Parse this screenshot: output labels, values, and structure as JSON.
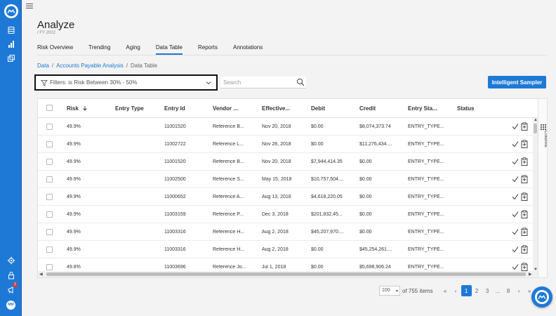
{
  "app": {
    "title": "Analyze",
    "subtitle": "/ FY 2022",
    "accent": "#1e79d6",
    "notification_count": "1",
    "avatar_initials": "MM"
  },
  "tabs": [
    {
      "label": "Risk Overview"
    },
    {
      "label": "Trending"
    },
    {
      "label": "Aging"
    },
    {
      "label": "Data Table",
      "active": true
    },
    {
      "label": "Reports"
    },
    {
      "label": "Annotations"
    }
  ],
  "breadcrumb": {
    "items": [
      "Data",
      "Accounts Payable Analysis",
      "Data Table"
    ],
    "separator": "/"
  },
  "filter": {
    "label": "Filters: is Risk Between 30% - 50%"
  },
  "search": {
    "placeholder": "Search"
  },
  "toolbar": {
    "sampler_label": "Intelligent Sampler",
    "columns_label": "Columns"
  },
  "table": {
    "columns": [
      "Risk",
      "Entry Type",
      "Entry Id",
      "Vendor ...",
      "Effective...",
      "Debit",
      "Credit",
      "Entry Sta...",
      "Status"
    ],
    "rows": [
      {
        "risk": "49.9%",
        "entry_type": "",
        "entry_id": "11001520",
        "vendor": "Reference B...",
        "effective": "Nov 20, 2018",
        "debit": "$0.00",
        "credit": "$8,074,373.74",
        "entry_status": "ENTRY_TYPE...",
        "status": ""
      },
      {
        "risk": "49.9%",
        "entry_type": "",
        "entry_id": "11002722",
        "vendor": "Reference L...",
        "effective": "Nov 28, 2018",
        "debit": "$0.00",
        "credit": "$11,276,434....",
        "entry_status": "ENTRY_TYPE...",
        "status": ""
      },
      {
        "risk": "49.9%",
        "entry_type": "",
        "entry_id": "11001520",
        "vendor": "Reference B...",
        "effective": "Nov 20, 2018",
        "debit": "$7,944,414.35",
        "credit": "$0.00",
        "entry_status": "ENTRY_TYPE...",
        "status": ""
      },
      {
        "risk": "49.9%",
        "entry_type": "",
        "entry_id": "11002500",
        "vendor": "Reference S...",
        "effective": "May 15, 2018",
        "debit": "$10,757,504....",
        "credit": "$0.00",
        "entry_status": "ENTRY_TYPE...",
        "status": ""
      },
      {
        "risk": "49.9%",
        "entry_type": "",
        "entry_id": "11000652",
        "vendor": "Reference A...",
        "effective": "Aug 13, 2018",
        "debit": "$4,618,220.05",
        "credit": "$0.00",
        "entry_status": "ENTRY_TYPE...",
        "status": ""
      },
      {
        "risk": "49.9%",
        "entry_type": "",
        "entry_id": "11003159",
        "vendor": "Reference P...",
        "effective": "Dec 3, 2018",
        "debit": "$201,832,45...",
        "credit": "$0.00",
        "entry_status": "ENTRY_TYPE...",
        "status": ""
      },
      {
        "risk": "49.9%",
        "entry_type": "",
        "entry_id": "11003316",
        "vendor": "Reference H...",
        "effective": "Aug 2, 2018",
        "debit": "$45,207,970....",
        "credit": "$0.00",
        "entry_status": "ENTRY_TYPE...",
        "status": ""
      },
      {
        "risk": "49.9%",
        "entry_type": "",
        "entry_id": "11003316",
        "vendor": "Reference H...",
        "effective": "Aug 2, 2018",
        "debit": "$0.00",
        "credit": "$45,254,261....",
        "entry_status": "ENTRY_TYPE...",
        "status": ""
      },
      {
        "risk": "49.8%",
        "entry_type": "",
        "entry_id": "11003696",
        "vendor": "Reference Jo...",
        "effective": "Jul 1, 2018",
        "debit": "$0.00",
        "credit": "$5,698,906.24",
        "entry_status": "ENTRY_TYPE...",
        "status": ""
      }
    ]
  },
  "pager": {
    "page_size": "100",
    "total_label": "of 755 items",
    "pages": [
      "1",
      "2",
      "3",
      "...",
      "8"
    ],
    "current": "1",
    "first": "«",
    "prev": "‹",
    "next": "›",
    "last": "»"
  }
}
